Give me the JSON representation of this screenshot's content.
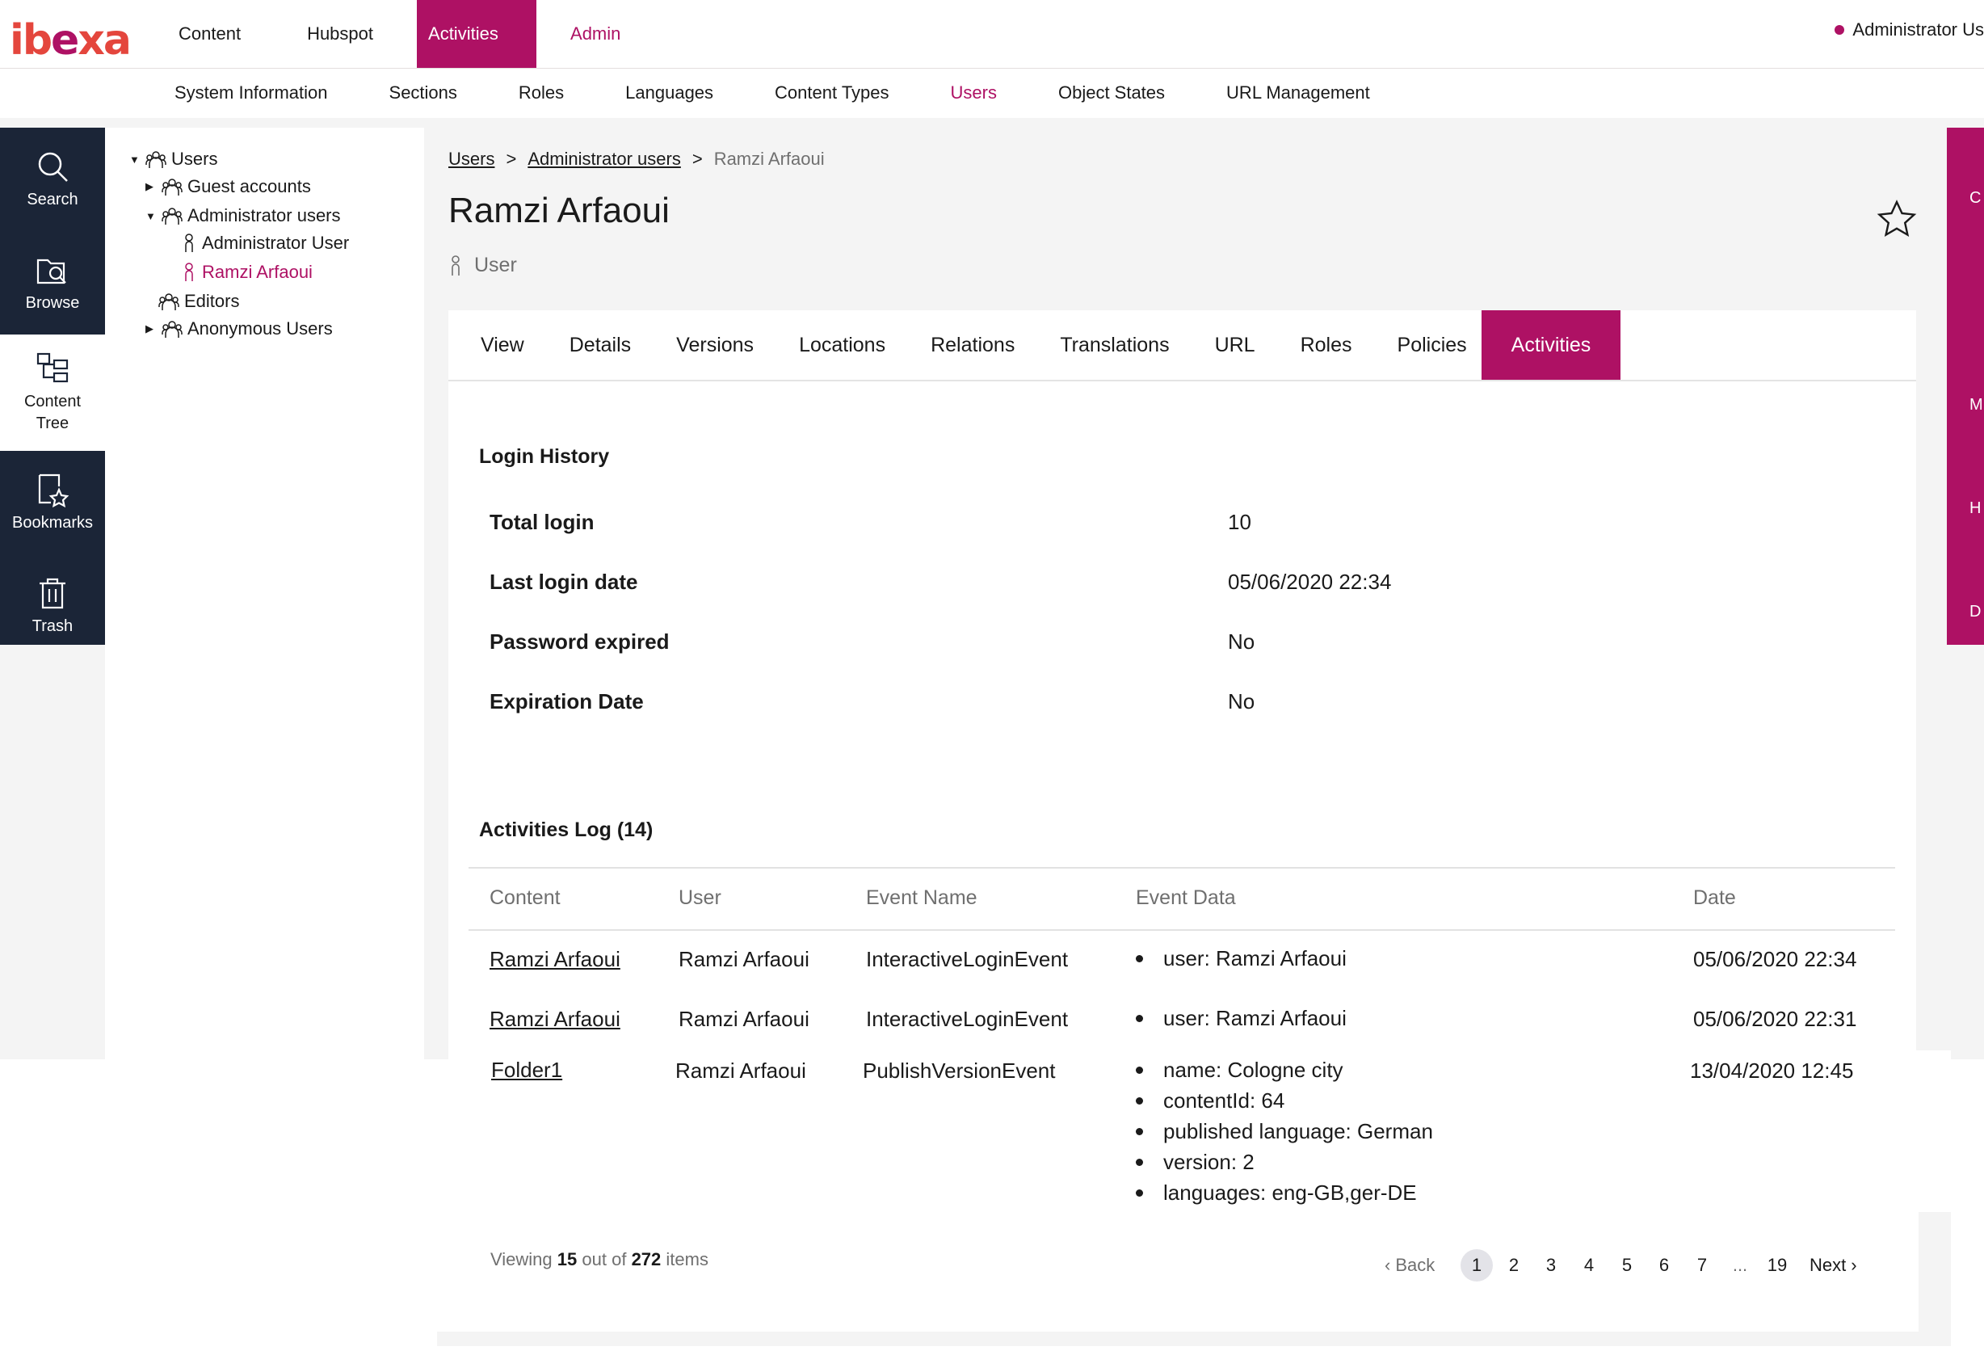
{
  "app": {
    "logo": "ibexa",
    "brand_color": "#ae1164"
  },
  "topnav": [
    {
      "label": "Content"
    },
    {
      "label": "Hubspot"
    },
    {
      "label": "Activities",
      "active": true
    },
    {
      "label": "Admin"
    }
  ],
  "user_menu": {
    "label": "Administrator Us"
  },
  "subnav": [
    {
      "label": "System Information"
    },
    {
      "label": "Sections"
    },
    {
      "label": "Roles"
    },
    {
      "label": "Languages"
    },
    {
      "label": "Content Types"
    },
    {
      "label": "Users",
      "active": true
    },
    {
      "label": "Object States"
    },
    {
      "label": "URL Management"
    }
  ],
  "sidebar": [
    {
      "label": "Search",
      "icon": "search-icon"
    },
    {
      "label": "Browse",
      "icon": "browse-icon"
    },
    {
      "label": "Content Tree",
      "icon": "content-tree-icon",
      "active": true
    },
    {
      "label": "Bookmarks",
      "icon": "bookmarks-icon"
    },
    {
      "label": "Trash",
      "icon": "trash-icon"
    }
  ],
  "tree": {
    "root": "Users",
    "guest": "Guest accounts",
    "admins": "Administrator users",
    "admin_user": "Administrator User",
    "ramzi": "Ramzi Arfaoui",
    "editors": "Editors",
    "anonymous": "Anonymous Users"
  },
  "breadcrumb": {
    "users": "Users",
    "admins": "Administrator users",
    "current": "Ramzi Arfaoui",
    "sep": ">"
  },
  "title": "Ramzi Arfaoui",
  "content_type": "User",
  "tabs": [
    {
      "label": "View"
    },
    {
      "label": "Details"
    },
    {
      "label": "Versions"
    },
    {
      "label": "Locations"
    },
    {
      "label": "Relations"
    },
    {
      "label": "Translations"
    },
    {
      "label": "URL"
    },
    {
      "label": "Roles"
    },
    {
      "label": "Policies"
    },
    {
      "label": "Activities",
      "active": true
    }
  ],
  "login_history": {
    "heading": "Login History",
    "rows": [
      {
        "label": "Total login",
        "value": "10"
      },
      {
        "label": "Last login date",
        "value": "05/06/2020 22:34"
      },
      {
        "label": "Password expired",
        "value": "No"
      },
      {
        "label": "Expiration Date",
        "value": "No"
      }
    ]
  },
  "activities_log": {
    "heading": "Activities Log (14)",
    "columns": {
      "content": "Content",
      "user": "User",
      "event_name": "Event Name",
      "event_data": "Event Data",
      "date": "Date"
    },
    "rows": [
      {
        "content": "Ramzi Arfaoui",
        "user": "Ramzi Arfaoui",
        "event": "InteractiveLoginEvent",
        "data": [
          "user: Ramzi Arfaoui"
        ],
        "date": "05/06/2020 22:34"
      },
      {
        "content": "Ramzi Arfaoui",
        "user": "Ramzi Arfaoui",
        "event": "InteractiveLoginEvent",
        "data": [
          "user: Ramzi Arfaoui"
        ],
        "date": "05/06/2020 22:31"
      },
      {
        "content": "Folder1",
        "user": "Ramzi Arfaoui",
        "event": "PublishVersionEvent",
        "data": [
          "name: Cologne city",
          "contentId: 64",
          "published language: German",
          "version: 2",
          "languages: eng-GB,ger-DE"
        ],
        "date": "13/04/2020 12:45"
      }
    ]
  },
  "pagination": {
    "viewing_prefix": "Viewing",
    "viewing_count": "15",
    "viewing_middle": "out of",
    "viewing_total": "272",
    "viewing_suffix": "items",
    "back": "Back",
    "pages": [
      "1",
      "2",
      "3",
      "4",
      "5",
      "6",
      "7",
      "...",
      "19"
    ],
    "current_page": "1",
    "next": "Next"
  },
  "right_panel_letters": [
    "C",
    "M",
    "H",
    "D"
  ]
}
